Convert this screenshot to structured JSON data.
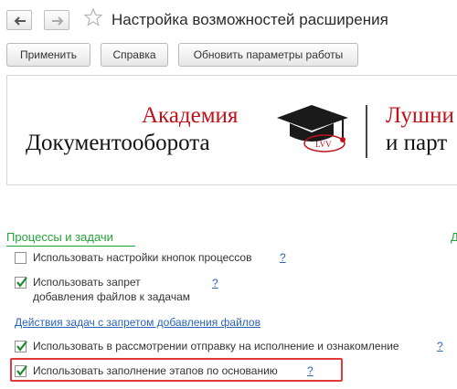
{
  "window": {
    "title": "Настройка возможностей расширения"
  },
  "toolbar": {
    "apply_label": "Применить",
    "help_label": "Справка",
    "refresh_label": "Обновить параметры работы"
  },
  "banner": {
    "line1": "Академия",
    "line2": "Документооборота",
    "partner_line1": "Лушни",
    "partner_line2": "и парт",
    "logo_badge": "LVV"
  },
  "section": {
    "title": "Процессы и задачи"
  },
  "options": {
    "buttons_settings": {
      "label": "Использовать настройки кнопок процессов",
      "checked": false,
      "help": "?"
    },
    "file_ban": {
      "label_line1": "Использовать запрет",
      "label_line2": "добавления файлов к задачам",
      "checked": true,
      "help": "?"
    },
    "review_send": {
      "label": "Использовать в рассмотрении отправку на исполнение и ознакомление",
      "checked": true,
      "help": "?"
    },
    "stages_fill": {
      "label": "Использовать заполнение этапов по основанию",
      "checked": true,
      "help": "?"
    }
  },
  "links": {
    "file_ban_actions": "Действия задач с запретом добавления файлов"
  },
  "colors": {
    "section_green": "#23a33a",
    "link_blue": "#2a64b8",
    "highlight_red": "#e23a3a",
    "brand_red": "#c0111a"
  }
}
